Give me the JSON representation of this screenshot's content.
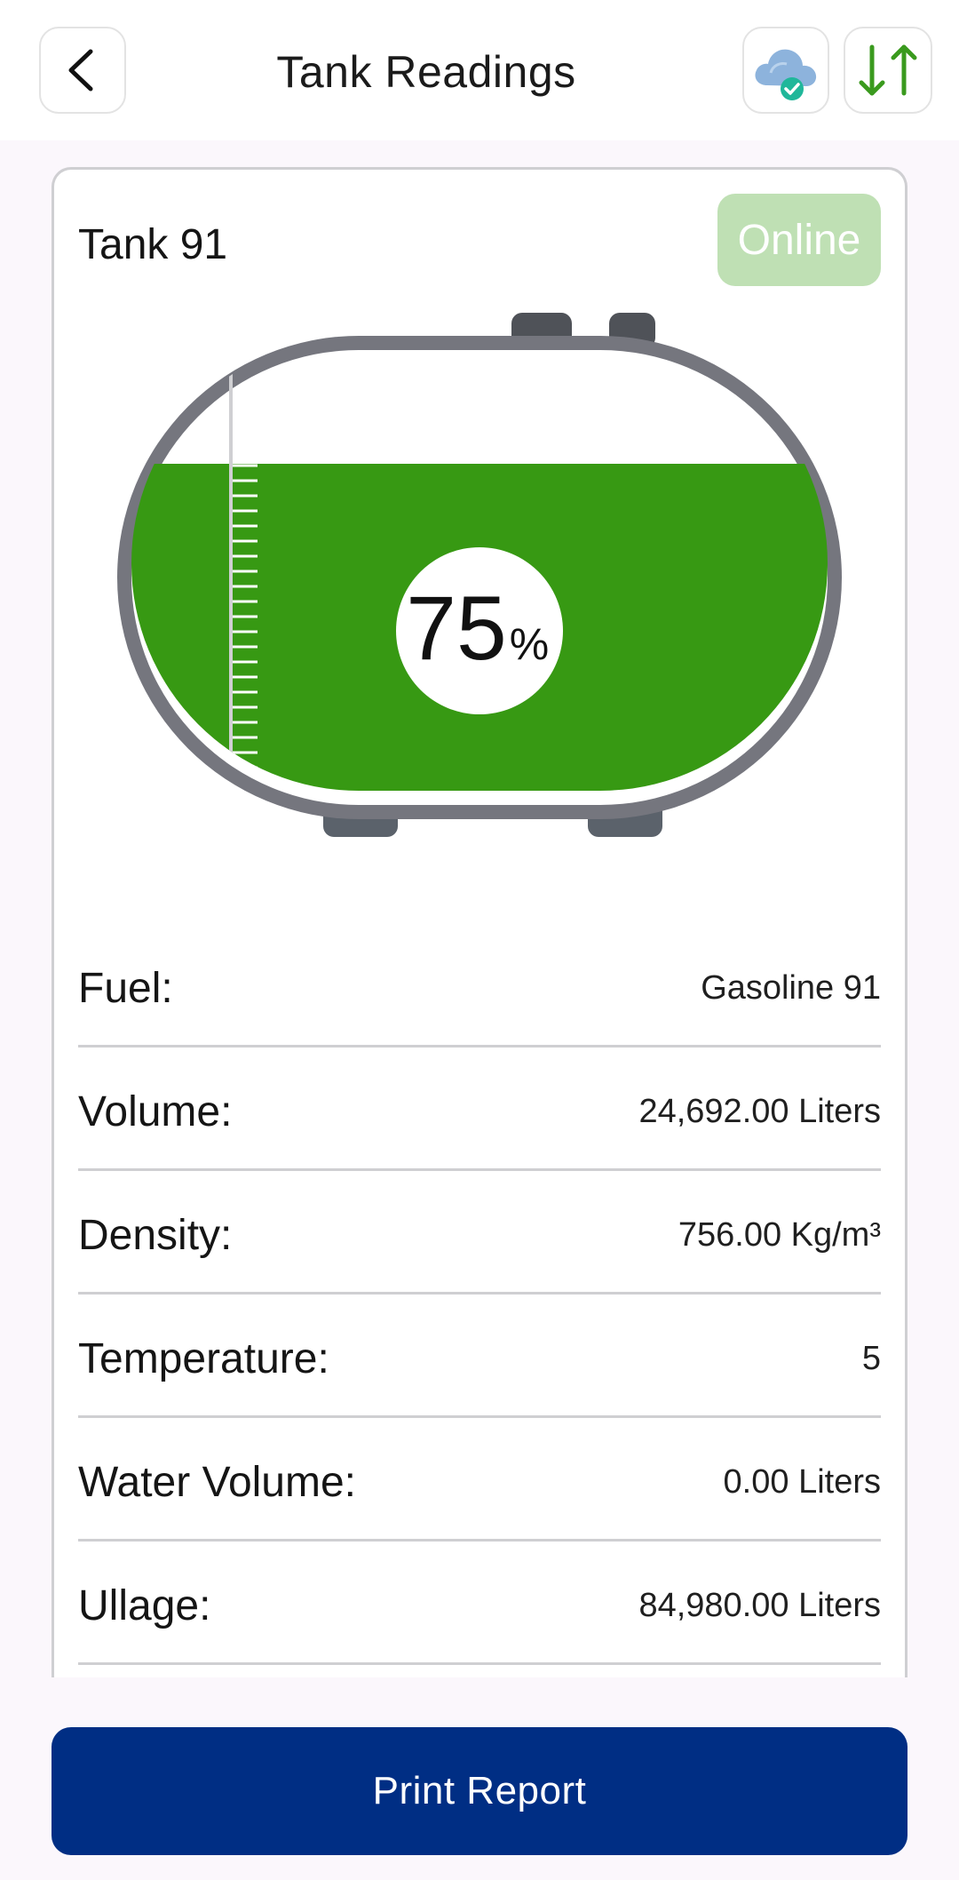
{
  "header": {
    "title": "Tank Readings",
    "back_icon": "chevron-left-icon",
    "cloud_icon": "cloud-check-icon",
    "sync_icon": "sync-arrows-icon"
  },
  "tank": {
    "name": "Tank 91",
    "status": "Online",
    "fill_level": 0.75,
    "percent_value": "75",
    "percent_unit": "%",
    "colors": {
      "fill": "#379913",
      "shell": "#6e6f78",
      "status_badge": "#bfe0b4",
      "sync_arrows": "#3a9a1e",
      "primary": "#002e84"
    }
  },
  "readings": [
    {
      "label": "Fuel:",
      "value": "Gasoline 91"
    },
    {
      "label": "Volume:",
      "value": "24,692.00 Liters"
    },
    {
      "label": "Density:",
      "value": "756.00 Kg/m³"
    },
    {
      "label": "Temperature:",
      "value": "5"
    },
    {
      "label": "Water Volume:",
      "value": "0.00 Liters"
    },
    {
      "label": "Ullage:",
      "value": "84,980.00 Liters"
    }
  ],
  "actions": {
    "print_label": "Print Report"
  }
}
